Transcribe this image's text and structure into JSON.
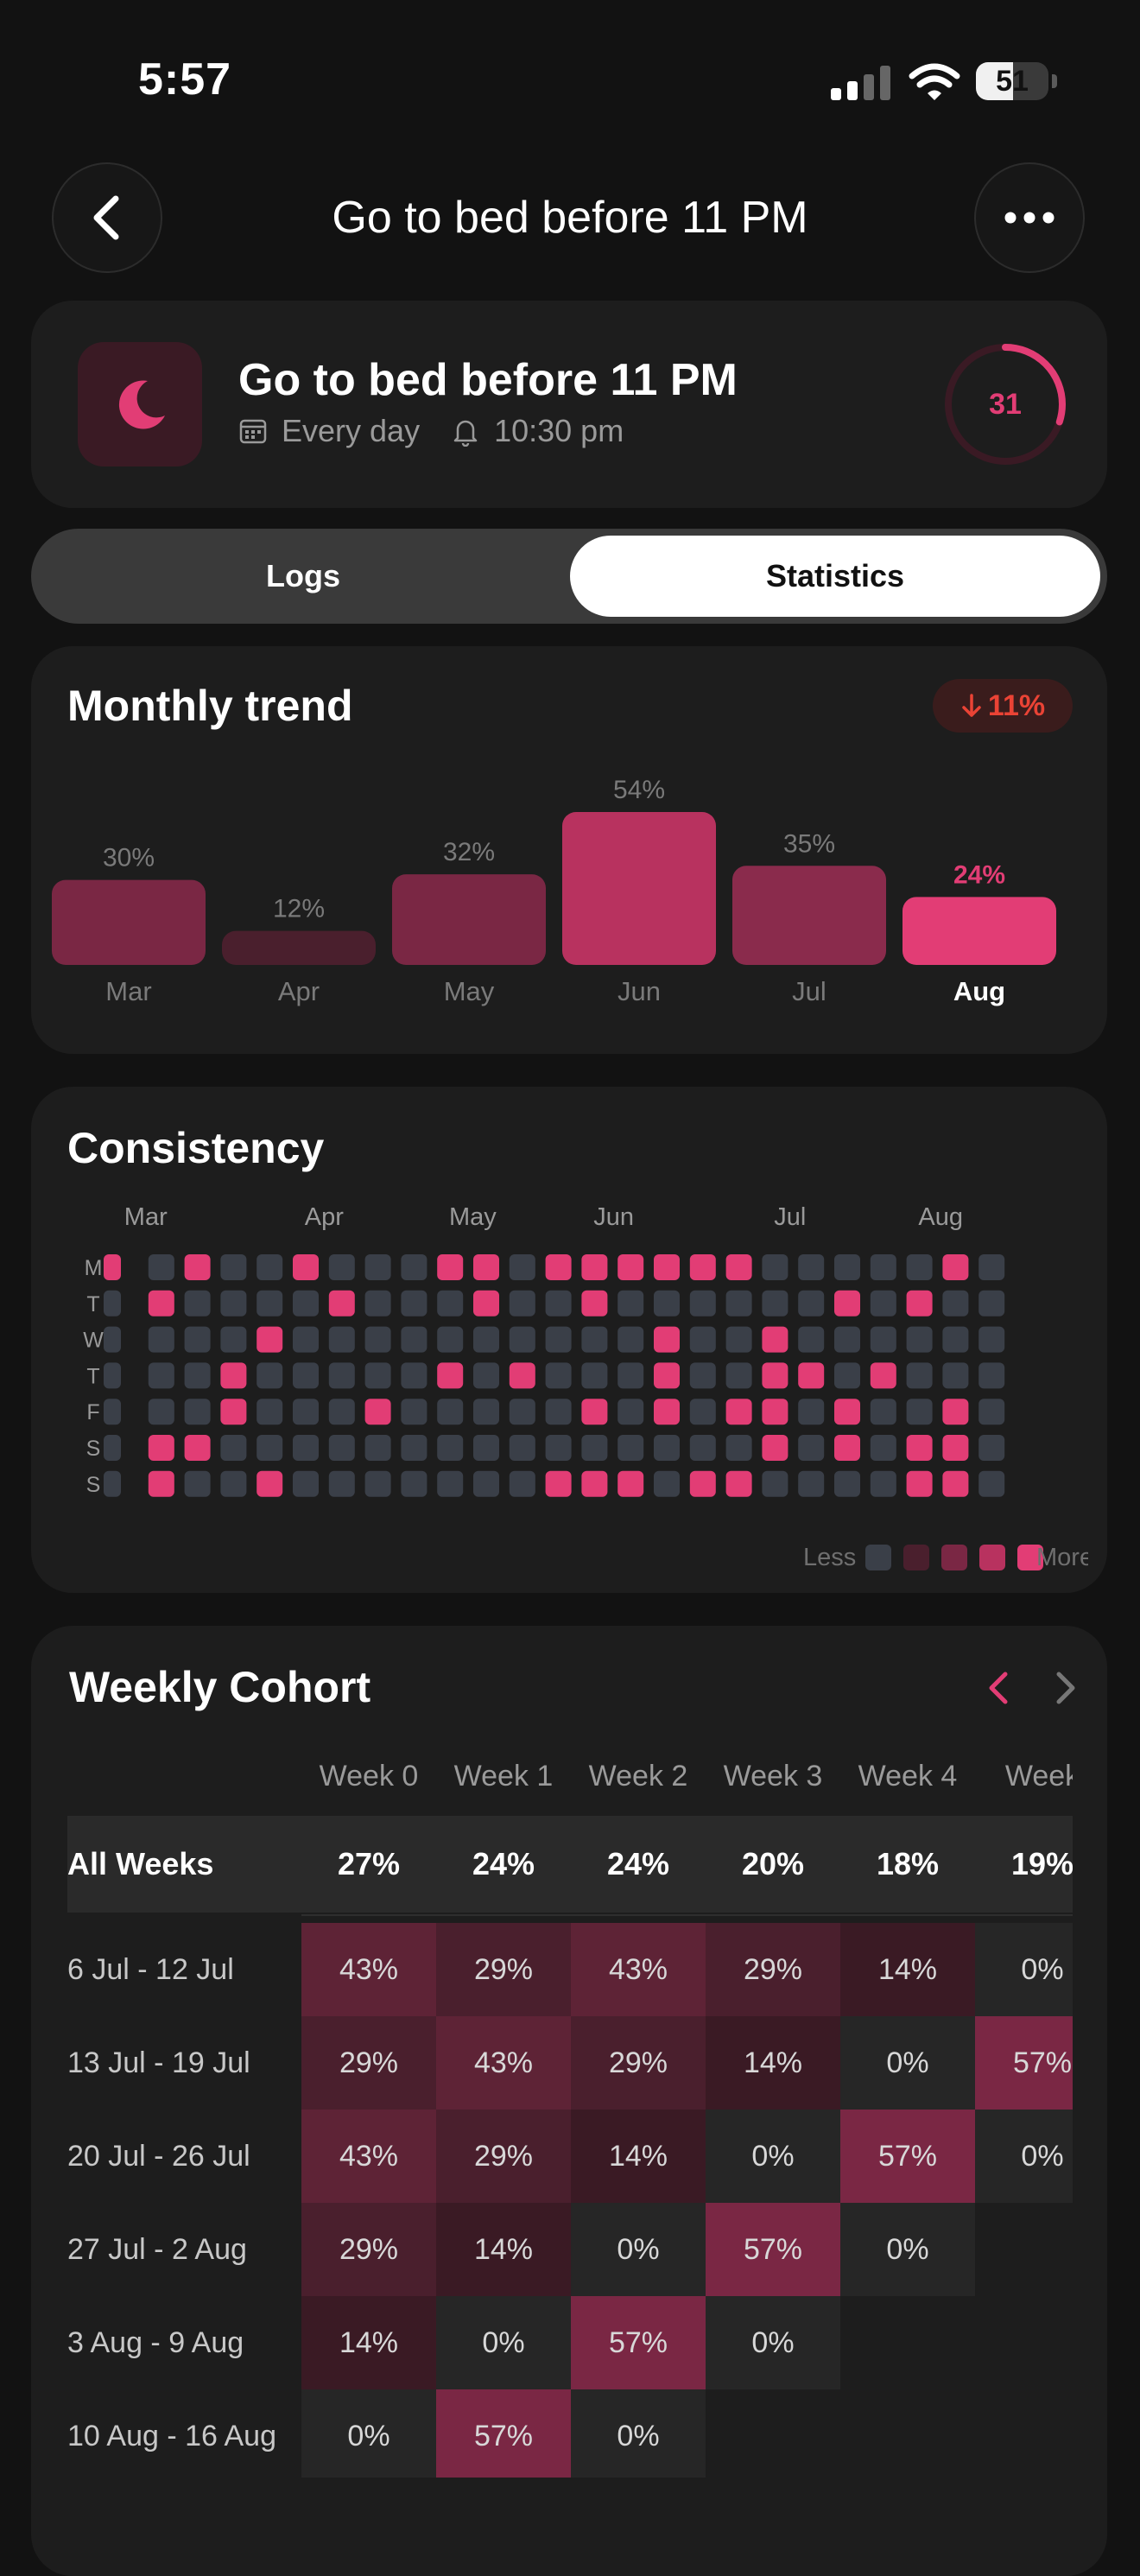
{
  "status_bar": {
    "time": "5:57",
    "battery": "51",
    "battery_level_percent": 51
  },
  "nav": {
    "title": "Go to bed before 11 PM",
    "back_icon": "chevron-left-icon",
    "more_icon": "ellipsis-icon"
  },
  "habit": {
    "title": "Go to bed before 11 PM",
    "frequency": "Every day",
    "reminder": "10:30 pm",
    "icon": "moon-icon",
    "streak": "31",
    "streak_progress": 0.3,
    "accent": "#e23d75"
  },
  "tabs": {
    "logs": "Logs",
    "statistics": "Statistics",
    "active": "statistics"
  },
  "monthly": {
    "title": "Monthly trend",
    "trend": "11%",
    "trend_direction": "down"
  },
  "chart_data": {
    "type": "bar",
    "categories": [
      "Mar",
      "Apr",
      "May",
      "Jun",
      "Jul",
      "Aug"
    ],
    "values": [
      30,
      12,
      32,
      54,
      35,
      24
    ],
    "labels": [
      "30%",
      "12%",
      "32%",
      "54%",
      "35%",
      "24%"
    ],
    "highlight": "Aug",
    "colors": [
      "#7a2744",
      "#4a1f2d",
      "#7a2744",
      "#b8325f",
      "#8a2b4c",
      "#e23d75"
    ]
  },
  "consistency": {
    "title": "Consistency",
    "months": [
      "Mar",
      "Apr",
      "May",
      "Jun",
      "Jul",
      "Aug"
    ],
    "days": [
      "M",
      "T",
      "W",
      "T",
      "F",
      "S",
      "S"
    ],
    "legend_less": "Less",
    "legend_more": "More",
    "grid": [
      "1010010001101111110000010",
      "0100001000100100000010100",
      "0000100000000001001000000",
      "0001000001010001001101000",
      "0001000100000101011010010",
      "0110000000000000001010110",
      "0100100000001110110000110"
    ]
  },
  "cohort": {
    "title": "Weekly Cohort",
    "headers": [
      "Week 0",
      "Week 1",
      "Week 2",
      "Week 3",
      "Week 4",
      "Week"
    ],
    "all_label": "All Weeks",
    "all_values": [
      "27%",
      "24%",
      "24%",
      "20%",
      "18%",
      "19%"
    ],
    "rows": [
      {
        "label": "6 Jul - 12 Jul",
        "values": [
          "43%",
          "29%",
          "43%",
          "29%",
          "14%",
          "0%"
        ]
      },
      {
        "label": "13 Jul - 19 Jul",
        "values": [
          "29%",
          "43%",
          "29%",
          "14%",
          "0%",
          "57%"
        ]
      },
      {
        "label": "20 Jul - 26 Jul",
        "values": [
          "43%",
          "29%",
          "14%",
          "0%",
          "57%",
          "0%"
        ]
      },
      {
        "label": "27 Jul - 2 Aug",
        "values": [
          "29%",
          "14%",
          "0%",
          "57%",
          "0%"
        ]
      },
      {
        "label": "3 Aug - 9 Aug",
        "values": [
          "14%",
          "0%",
          "57%",
          "0%"
        ]
      },
      {
        "label": "10 Aug - 16 Aug",
        "values": [
          "0%",
          "57%",
          "0%"
        ]
      }
    ]
  }
}
